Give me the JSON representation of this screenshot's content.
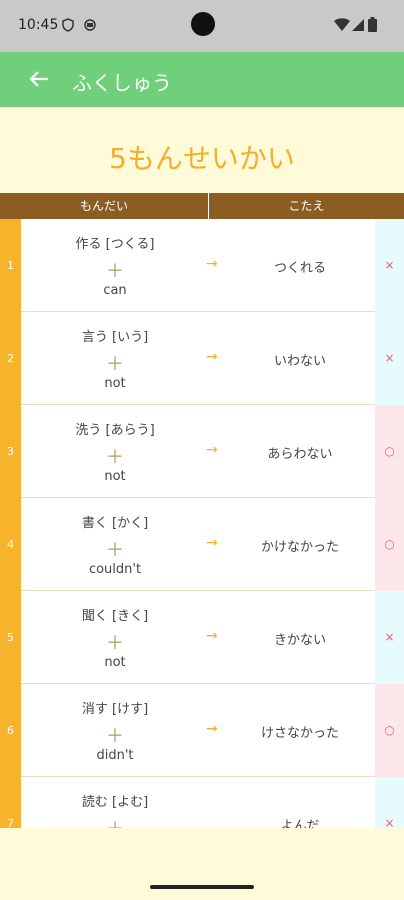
{
  "status": {
    "time": "10:45"
  },
  "app_bar": {
    "title": "ふくしゅう"
  },
  "score": {
    "text": "5もんせいかい"
  },
  "table_header": {
    "question": "もんだい",
    "answer": "こたえ"
  },
  "rows": [
    {
      "num": "1",
      "verb": "作る [つくる]",
      "plus": "＋",
      "form": "can",
      "arrow": "→",
      "answer": "つくれる",
      "mark": "×",
      "mark_color": "#e6fbfc"
    },
    {
      "num": "2",
      "verb": "言う [いう]",
      "plus": "＋",
      "form": "not",
      "arrow": "→",
      "answer": "いわない",
      "mark": "×",
      "mark_color": "#e6fbfc"
    },
    {
      "num": "3",
      "verb": "洗う [あらう]",
      "plus": "＋",
      "form": "not",
      "arrow": "→",
      "answer": "あらわない",
      "mark": "○",
      "mark_color": "#fde7ea"
    },
    {
      "num": "4",
      "verb": "書く [かく]",
      "plus": "＋",
      "form": "couldn't",
      "arrow": "→",
      "answer": "かけなかった",
      "mark": "○",
      "mark_color": "#fde7ea"
    },
    {
      "num": "5",
      "verb": "聞く [きく]",
      "plus": "＋",
      "form": "not",
      "arrow": "→",
      "answer": "きかない",
      "mark": "×",
      "mark_color": "#e6fbfc"
    },
    {
      "num": "6",
      "verb": "消す [けす]",
      "plus": "＋",
      "form": "didn't",
      "arrow": "→",
      "answer": "けさなかった",
      "mark": "○",
      "mark_color": "#fde7ea"
    },
    {
      "num": "7",
      "verb": "読む [よむ]",
      "plus": "＋",
      "form": "",
      "arrow": "",
      "answer": "よんだ",
      "mark": "×",
      "mark_color": "#e6fbfc"
    }
  ]
}
